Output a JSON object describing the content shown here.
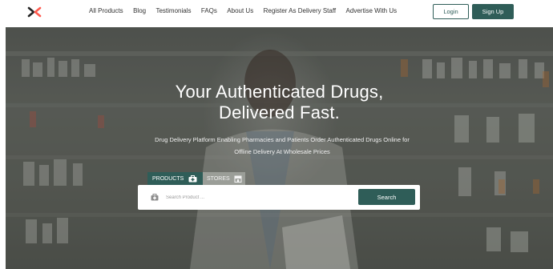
{
  "brand": {
    "logo_icon": "brand-logo-icon",
    "accent": "#2f5d58",
    "logo_color": "#ff5a4e"
  },
  "nav": {
    "items": [
      {
        "label": "All Products"
      },
      {
        "label": "Blog"
      },
      {
        "label": "Testimonials"
      },
      {
        "label": "FAQs"
      },
      {
        "label": "About Us"
      },
      {
        "label": "Register As Delivery Staff"
      },
      {
        "label": "Advertise With Us"
      }
    ],
    "login_label": "Login",
    "signup_label": "Sign Up"
  },
  "hero": {
    "title_line1": "Your Authenticated Drugs,",
    "title_line2": "Delivered Fast.",
    "subtitle_line1": "Drug Delivery Platform Enabling Pharmacies and Patients Order Authenticated Drugs Online for",
    "subtitle_line2": "Offline Delivery At Wholesale Prices"
  },
  "search": {
    "tabs": [
      {
        "label": "PRODUCTS",
        "icon": "medkit-icon",
        "active": true
      },
      {
        "label": "STORES",
        "icon": "store-icon",
        "active": false
      }
    ],
    "placeholder": "Search Product ...",
    "value": "",
    "button_label": "Search"
  }
}
